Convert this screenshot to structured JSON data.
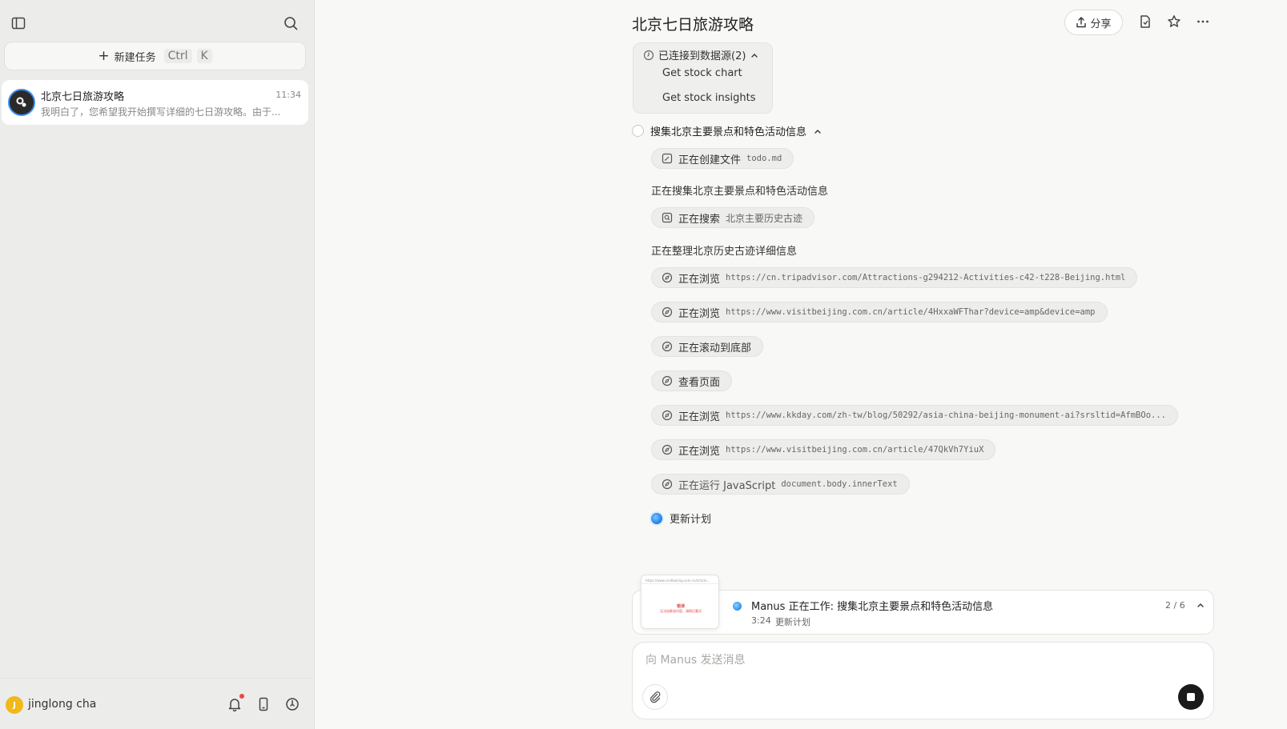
{
  "sidebar": {
    "toggle_icon": "sidebar-toggle-icon",
    "search_icon": "search-icon",
    "new_task": {
      "label": "新建任务",
      "shortcut_1": "Ctrl",
      "shortcut_2": "K"
    },
    "tasks": [
      {
        "title": "北京七日旅游攻略",
        "time": "11:34",
        "preview": "我明白了，您希望我开始撰写详细的七日游攻略。由于..."
      }
    ],
    "user": {
      "initial": "J",
      "name": "jinglong cha"
    }
  },
  "header": {
    "title": "北京七日旅游攻略",
    "share_label": "分享"
  },
  "data_sources": {
    "label": "已连接到数据源(2)",
    "items": [
      "Get stock chart",
      "Get stock insights"
    ]
  },
  "step": {
    "title": "搜集北京主要景点和特色活动信息",
    "events": [
      {
        "kind": "chip",
        "icon": "edit-file-icon",
        "action": "正在创建文件",
        "arg": "todo.md",
        "mono": true
      },
      {
        "kind": "text",
        "text": "正在搜集北京主要景点和特色活动信息"
      },
      {
        "kind": "chip",
        "icon": "search-icon",
        "action": "正在搜索",
        "arg": "北京主要历史古迹",
        "mono": false
      },
      {
        "kind": "text",
        "text": "正在整理北京历史古迹详细信息"
      },
      {
        "kind": "chip",
        "icon": "browser-icon",
        "action": "正在浏览",
        "arg": "https://cn.tripadvisor.com/Attractions-g294212-Activities-c42-t228-Beijing.html",
        "mono": true
      },
      {
        "kind": "chip",
        "icon": "browser-icon",
        "action": "正在浏览",
        "arg": "https://www.visitbeijing.com.cn/article/4HxxaWFThar?device=amp&device=amp",
        "mono": true
      },
      {
        "kind": "chip",
        "icon": "browser-icon",
        "action": "正在滚动到底部",
        "arg": "",
        "mono": true
      },
      {
        "kind": "chip",
        "icon": "browser-icon",
        "action": "查看页面",
        "arg": "",
        "mono": true
      },
      {
        "kind": "chip",
        "icon": "browser-icon",
        "action": "正在浏览",
        "arg": "https://www.kkday.com/zh-tw/blog/50292/asia-china-beijing-monument-ai?srsltid=AfmBOo...",
        "mono": true
      },
      {
        "kind": "chip",
        "icon": "browser-icon",
        "action": "正在浏览",
        "arg": "https://www.visitbeijing.com.cn/article/47QkVh7YiuX",
        "mono": true
      },
      {
        "kind": "chip",
        "icon": "browser-icon",
        "action": "正在运行 JavaScript",
        "arg": "document.body.innerText",
        "mono": true
      }
    ],
    "update_plan": "更新计划"
  },
  "status": {
    "title": "Manus 正在工作: 搜集北京主要景点和特色活动信息",
    "time": "3:24",
    "subtitle": "更新计划",
    "progress": "2 / 6"
  },
  "composer": {
    "placeholder": "向 Manus 发送消息"
  }
}
